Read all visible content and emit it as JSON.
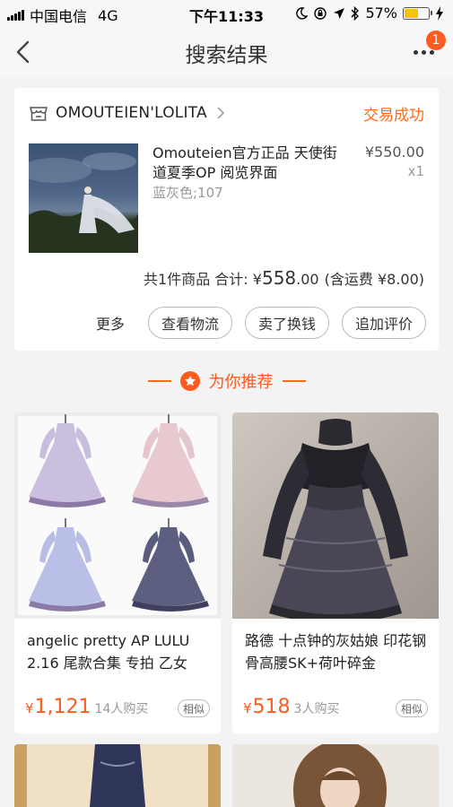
{
  "status_bar": {
    "carrier": "中国电信",
    "network": "4G",
    "time": "下午11:33",
    "battery": "57%",
    "battery_level": 0.57
  },
  "nav": {
    "title": "搜索结果",
    "badge_count": "1"
  },
  "order": {
    "shop_name": "OMOUTEIEN'LOLITA",
    "status": "交易成功",
    "product_title": "Omouteien官方正品 天使街道夏季OP 阅览界面",
    "variant": "蓝灰色;107",
    "price": "¥550.00",
    "quantity": "x1",
    "summary_prefix": "共1件商品 合计: ¥",
    "total_int": "558",
    "total_dec": ".00",
    "shipping": "(含运费 ¥8.00)",
    "more_label": "更多",
    "buttons": [
      "查看物流",
      "卖了换钱",
      "追加评价"
    ]
  },
  "recommend": {
    "title": "为你推荐"
  },
  "products": [
    {
      "title": "angelic pretty AP LULU 2.16 尾款合集 专拍 乙女",
      "currency": "¥",
      "price": "1,121",
      "sold": "14人购买",
      "similar": "相似"
    },
    {
      "title": "路德 十点钟的灰姑娘 印花钢骨高腰SK+荷叶碎金",
      "currency": "¥",
      "price": "518",
      "sold": "3人购买",
      "similar": "相似"
    }
  ],
  "colors": {
    "accent": "#ff5a1f",
    "status_orange": "#ff6a1a"
  }
}
